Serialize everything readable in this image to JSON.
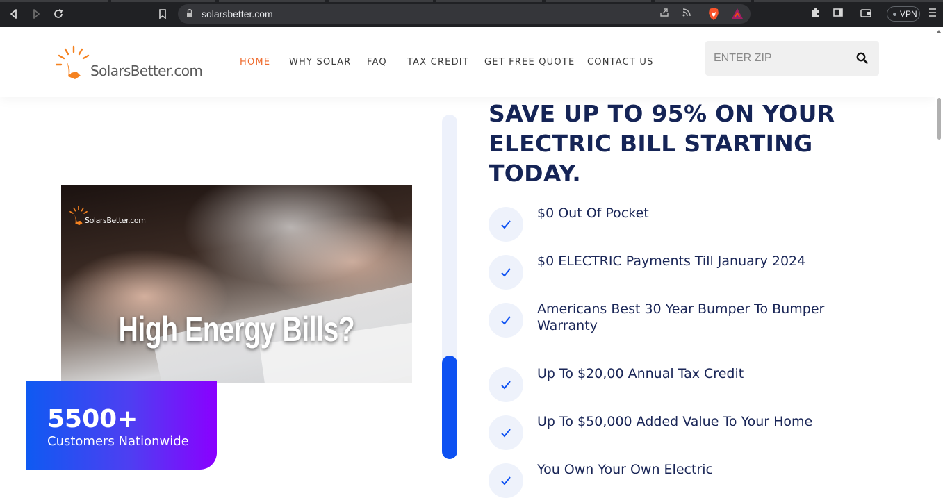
{
  "browser": {
    "url": "solarsbetter.com",
    "vpn_label": "VPN"
  },
  "site": {
    "logo_text": "SolarsBetter.com",
    "nav": [
      {
        "label": "HOME",
        "active": true
      },
      {
        "label": "WHY SOLAR",
        "active": false
      },
      {
        "label": "FAQ",
        "active": false
      },
      {
        "label": "TAX CREDIT",
        "active": false
      },
      {
        "label": "GET FREE QUOTE",
        "active": false
      },
      {
        "label": "CONTACT US",
        "active": false
      }
    ],
    "zip_placeholder": "ENTER ZIP",
    "accent_color": "#ef6a2c",
    "title_color": "#152456",
    "brand_blue": "#0d51f2"
  },
  "hero": {
    "image_logo_text": "SolarsBetter.com",
    "image_headline": "High Energy Bills?",
    "stat_number": "5500+",
    "stat_label": "Customers Nationwide",
    "title": "SAVE UP TO 95% ON YOUR ELECTRIC BILL STARTING TODAY.",
    "scroll_progress_fraction": 0.3,
    "benefits": [
      "$0 Out Of Pocket",
      "$0 ELECTRIC Payments Till January 2024",
      "Americans Best 30 Year Bumper To Bumper Warranty",
      "Up To $20,00 Annual Tax Credit",
      "Up To $50,000 Added Value To Your Home",
      "You Own Your Own Electric"
    ]
  }
}
